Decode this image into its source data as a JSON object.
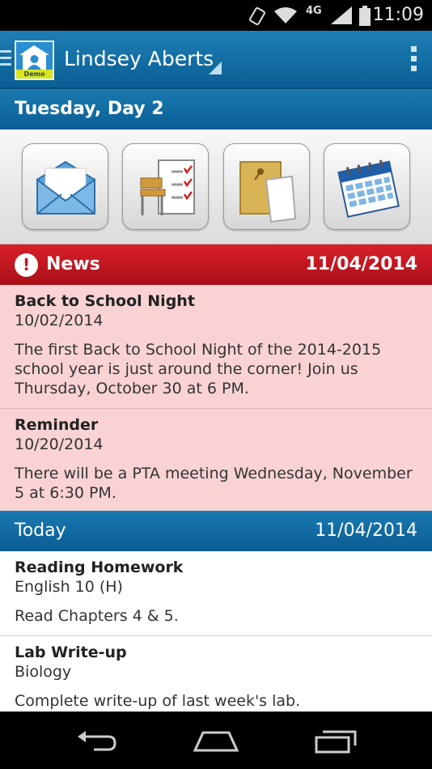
{
  "status_bar": {
    "time": "11:09",
    "network": "4G"
  },
  "header": {
    "user_name": "Lindsey Aberts",
    "logo_badge": "Demo"
  },
  "day": {
    "title": "Tuesday, Day 2"
  },
  "tiles": [
    {
      "icon": "mail-icon"
    },
    {
      "icon": "attendance-icon"
    },
    {
      "icon": "documents-icon"
    },
    {
      "icon": "calendar-icon"
    }
  ],
  "news": {
    "label": "News",
    "date": "11/04/2014",
    "items": [
      {
        "title": "Back to School Night",
        "date": "10/02/2014",
        "body": "The first Back to School Night of the 2014-2015 school year is just around the corner!  Join us Thursday, October 30 at 6 PM."
      },
      {
        "title": "Reminder",
        "date": "10/20/2014",
        "body": "There will be a PTA meeting Wednesday, November 5 at 6:30 PM."
      }
    ]
  },
  "today": {
    "label": "Today",
    "date": "11/04/2014",
    "items": [
      {
        "title": "Reading Homework",
        "course": "English 10 (H)",
        "body": "Read Chapters 4 & 5."
      },
      {
        "title": "Lab Write-up",
        "course": "Biology",
        "body": "Complete write-up of last week's lab."
      }
    ]
  },
  "colors": {
    "brand_blue": "#0b5f95",
    "news_red": "#c4141d",
    "news_bg": "#f9d3d4"
  }
}
